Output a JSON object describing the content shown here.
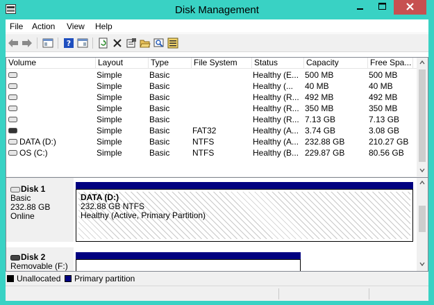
{
  "window": {
    "title": "Disk Management"
  },
  "menu": [
    "File",
    "Action",
    "View",
    "Help"
  ],
  "columns": [
    "Volume",
    "Layout",
    "Type",
    "File System",
    "Status",
    "Capacity",
    "Free Spa..."
  ],
  "rows": [
    {
      "volume": "",
      "layout": "Simple",
      "type": "Basic",
      "fs": "",
      "status": "Healthy (E...",
      "capacity": "500 MB",
      "free": "500 MB"
    },
    {
      "volume": "",
      "layout": "Simple",
      "type": "Basic",
      "fs": "",
      "status": "Healthy (...",
      "capacity": "40 MB",
      "free": "40 MB"
    },
    {
      "volume": "",
      "layout": "Simple",
      "type": "Basic",
      "fs": "",
      "status": "Healthy (R...",
      "capacity": "492 MB",
      "free": "492 MB"
    },
    {
      "volume": "",
      "layout": "Simple",
      "type": "Basic",
      "fs": "",
      "status": "Healthy (R...",
      "capacity": "350 MB",
      "free": "350 MB"
    },
    {
      "volume": "",
      "layout": "Simple",
      "type": "Basic",
      "fs": "",
      "status": "Healthy (R...",
      "capacity": "7.13 GB",
      "free": "7.13 GB"
    },
    {
      "volume": "",
      "layout": "Simple",
      "type": "Basic",
      "fs": "FAT32",
      "status": "Healthy (A...",
      "capacity": "3.74 GB",
      "free": "3.08 GB"
    },
    {
      "volume": "DATA (D:)",
      "layout": "Simple",
      "type": "Basic",
      "fs": "NTFS",
      "status": "Healthy (A...",
      "capacity": "232.88 GB",
      "free": "210.27 GB"
    },
    {
      "volume": "OS (C:)",
      "layout": "Simple",
      "type": "Basic",
      "fs": "NTFS",
      "status": "Healthy (B...",
      "capacity": "229.87 GB",
      "free": "80.56 GB"
    }
  ],
  "disks": [
    {
      "name": "Disk 1",
      "kind": "Basic",
      "size": "232.88 GB",
      "state": "Online",
      "partition": {
        "title": "DATA  (D:)",
        "size_fs": "232.88 GB NTFS",
        "health": "Healthy (Active, Primary Partition)"
      }
    },
    {
      "name": "Disk 2",
      "kind": "Removable (F:)"
    }
  ],
  "legend": [
    {
      "label": "Unallocated",
      "color": "#000000"
    },
    {
      "label": "Primary partition",
      "color": "#000080"
    }
  ],
  "colors": {
    "titlebar": "#39d2c4",
    "close": "#c75050",
    "primary": "#000080"
  }
}
